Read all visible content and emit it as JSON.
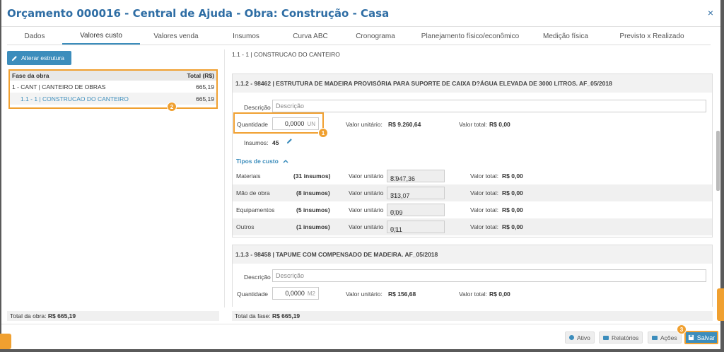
{
  "header": {
    "title": "Orçamento 000016 - Central de Ajuda - Obra: Construção - Casa",
    "close": "×"
  },
  "tabs": [
    {
      "label": "Dados"
    },
    {
      "label": "Valores custo"
    },
    {
      "label": "Valores venda"
    },
    {
      "label": "Insumos"
    },
    {
      "label": "Curva ABC"
    },
    {
      "label": "Cronograma"
    },
    {
      "label": "Planejamento físico/econômico"
    },
    {
      "label": "Medição física"
    },
    {
      "label": "Previsto x Realizado"
    }
  ],
  "left": {
    "alter_button": "Alterar estrutura",
    "col_phase": "Fase da obra",
    "col_total": "Total (R$)",
    "rows": [
      {
        "label": "1 - CANT | CANTEIRO DE OBRAS",
        "value": "665,19"
      },
      {
        "label": "1.1 - 1 | CONSTRUCAO DO CANTEIRO",
        "value": "665,19"
      }
    ],
    "footer_label": "Total da obra:",
    "footer_value": "R$ 665,19"
  },
  "right": {
    "breadcrumb": "1.1 - 1 | CONSTRUCAO DO CANTEIRO",
    "card1": {
      "title": "1.1.2 - 98462 | ESTRUTURA DE MADEIRA PROVISÓRIA PARA SUPORTE DE CAIXA D?ÁGUA ELEVADA DE 3000 LITROS. AF_05/2018",
      "desc_label": "Descrição",
      "desc_placeholder": "Descrição",
      "qty_label": "Quantidade",
      "qty_value": "0,0000",
      "qty_unit": "UN",
      "vu_label": "Valor unitário:",
      "vu_value": "R$ 9.260,64",
      "vt_label": "Valor total:",
      "vt_value": "R$ 0,00",
      "insumos_label": "Insumos:",
      "insumos_value": "45",
      "tipos_label": "Tipos de custo",
      "rows": [
        {
          "name": "Materiais",
          "count": "(31 insumos)",
          "vu_label": "Valor unitário",
          "rs": "R$",
          "value": "8.947,36",
          "vt_label": "Valor total:",
          "vt": "R$ 0,00"
        },
        {
          "name": "Mão de obra",
          "count": "(8 insumos)",
          "vu_label": "Valor unitário",
          "rs": "R$",
          "value": "313,07",
          "vt_label": "Valor total:",
          "vt": "R$ 0,00"
        },
        {
          "name": "Equipamentos",
          "count": "(5 insumos)",
          "vu_label": "Valor unitário",
          "rs": "R$",
          "value": "0,09",
          "vt_label": "Valor total:",
          "vt": "R$ 0,00"
        },
        {
          "name": "Outros",
          "count": "(1 insumos)",
          "vu_label": "Valor unitário",
          "rs": "R$",
          "value": "0,11",
          "vt_label": "Valor total:",
          "vt": "R$ 0,00"
        }
      ]
    },
    "card2": {
      "title": "1.1.3 - 98458 | TAPUME COM COMPENSADO DE MADEIRA. AF_05/2018",
      "desc_label": "Descrição",
      "desc_placeholder": "Descrição",
      "qty_label": "Quantidade",
      "qty_value": "0,0000",
      "qty_unit": "M2",
      "vu_label": "Valor unitário:",
      "vu_value": "R$ 156,68",
      "vt_label": "Valor total:",
      "vt_value": "R$ 0,00"
    },
    "footer_label": "Total da fase:",
    "footer_value": "R$ 665,19"
  },
  "bottom": {
    "ativo": "Ativo",
    "relatorios": "Relatórios",
    "acoes": "Ações",
    "salvar": "Salvar"
  },
  "markers": [
    "1",
    "2",
    "3"
  ],
  "colors": {
    "accent": "#3c8dbc",
    "highlight": "#f0a030",
    "title": "#2e6da4"
  }
}
